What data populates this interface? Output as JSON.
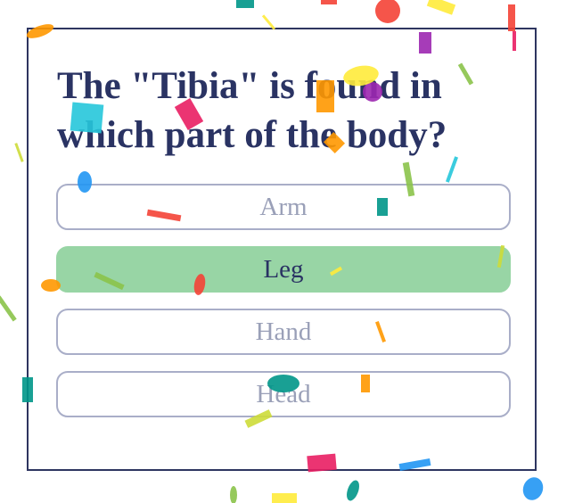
{
  "quiz": {
    "question": "The \"Tibia\" is found in which part of the body?",
    "answers": [
      {
        "label": "Arm",
        "state": "default"
      },
      {
        "label": "Leg",
        "state": "correct"
      },
      {
        "label": "Hand",
        "state": "default"
      },
      {
        "label": "Head",
        "state": "default"
      }
    ]
  },
  "colors": {
    "text": "#2a3363",
    "border": "#2e3560",
    "correct": "#98d5a5",
    "muted": "#9aa0b8",
    "confetti": [
      "#f44336",
      "#9c27b0",
      "#ffeb3b",
      "#ff9800",
      "#26c6da",
      "#2196f3",
      "#009688",
      "#e91e63",
      "#8bc34a",
      "#cddc39"
    ]
  }
}
